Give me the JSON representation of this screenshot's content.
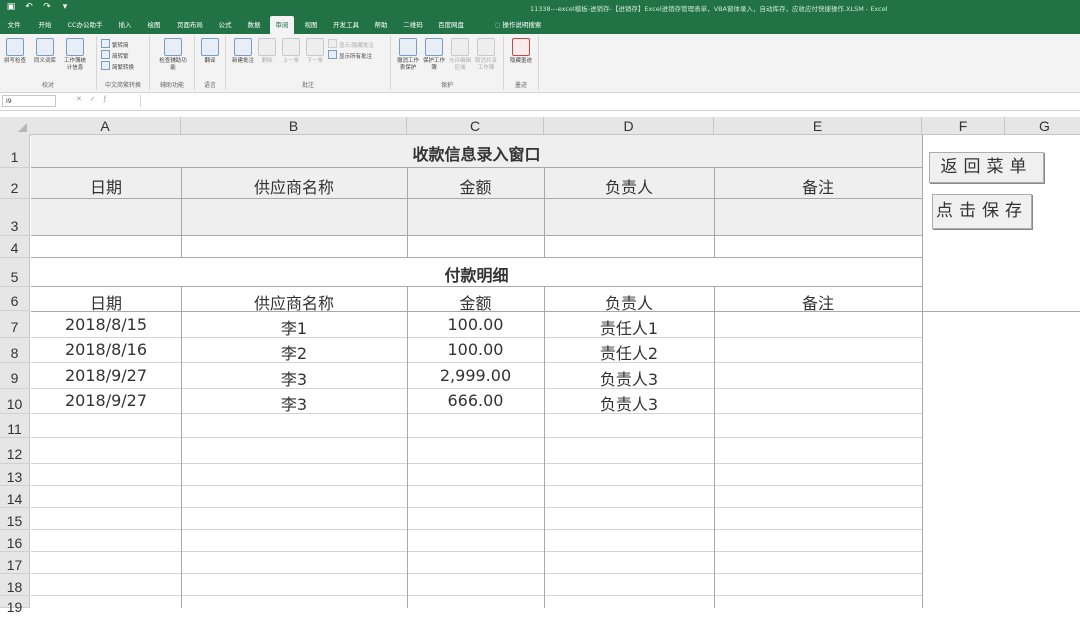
{
  "window": {
    "title": "11338---excel模板-进销存-【进销存】Excel进销存管理表单，VBA窗体录入，自动库存，应收应付快捷操作.XLSM  -  Excel"
  },
  "ribbon_tabs": [
    "文件",
    "开始",
    "CC办公助手",
    "插入",
    "绘图",
    "页面布局",
    "公式",
    "数据",
    "审阅",
    "视图",
    "开发工具",
    "帮助",
    "二维码",
    "百度网盘"
  ],
  "active_tab": "审阅",
  "tell_me": "操作说明搜索",
  "ribbon": {
    "groups": [
      {
        "label": "校对",
        "buttons": [
          "拼写检查",
          "同义词库",
          "工作簿统计信息"
        ]
      },
      {
        "label": "中文简繁转换",
        "items": [
          "繁转简",
          "简转繁",
          "简繁转换"
        ]
      },
      {
        "label": "辅助功能",
        "buttons": [
          "检查辅助功能"
        ]
      },
      {
        "label": "语言",
        "buttons": [
          "翻译"
        ]
      },
      {
        "label": "批注",
        "buttons": [
          "新建批注",
          "删除",
          "上一条",
          "下一条"
        ],
        "items": [
          "显示/隐藏批注",
          "显示所有批注"
        ]
      },
      {
        "label": "保护",
        "buttons": [
          "撤消工作表保护",
          "保护工作簿",
          "允许编辑区域",
          "取消共享工作簿"
        ]
      },
      {
        "label": "墨迹",
        "buttons": [
          "隐藏墨迹"
        ]
      }
    ]
  },
  "formula_bar": {
    "name_box": "I9",
    "formula": ""
  },
  "columns": [
    "A",
    "B",
    "C",
    "D",
    "E",
    "F",
    "G"
  ],
  "rows": [
    "1",
    "2",
    "3",
    "4",
    "5",
    "6",
    "7",
    "8",
    "9",
    "10",
    "11",
    "12",
    "13",
    "14",
    "15",
    "16",
    "17",
    "18",
    "19"
  ],
  "sheet": {
    "title1": "收款信息录入窗口",
    "headers1": [
      "日期",
      "供应商名称",
      "金额",
      "负责人",
      "备注"
    ],
    "title2": "付款明细",
    "headers2": [
      "日期",
      "供应商名称",
      "金额",
      "负责人",
      "备注"
    ],
    "data_rows": [
      [
        "2018/8/15",
        "李1",
        "100.00",
        "责任人1",
        ""
      ],
      [
        "2018/8/16",
        "李2",
        "100.00",
        "责任人2",
        ""
      ],
      [
        "2018/9/27",
        "李3",
        "2,999.00",
        "负责人3",
        ""
      ],
      [
        "2018/9/27",
        "李3",
        "666.00",
        "负责人3",
        ""
      ]
    ]
  },
  "buttons": {
    "return_menu": "返回菜单",
    "save": "点击保存"
  }
}
